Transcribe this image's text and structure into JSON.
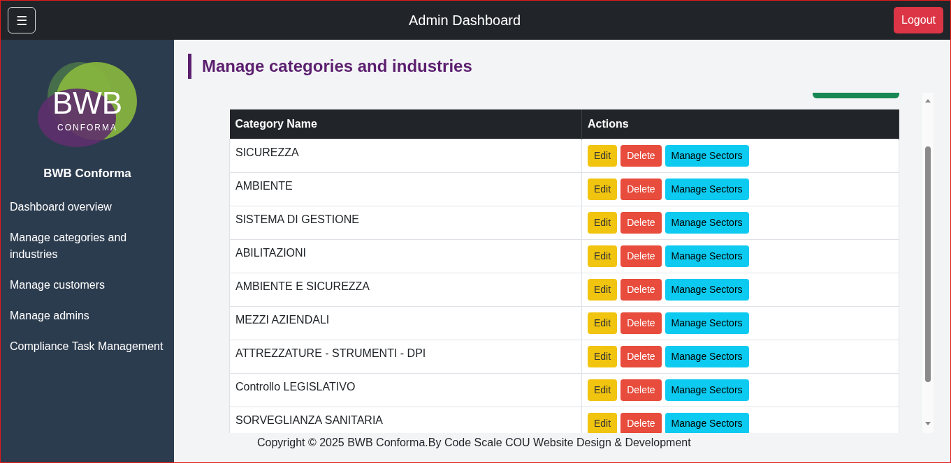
{
  "header": {
    "menu_button": "☰",
    "title": "Admin Dashboard",
    "logout": "Logout"
  },
  "sidebar": {
    "logo": {
      "mark": "BWB",
      "subtitle": "CONFORMA"
    },
    "brand": "BWB Conforma",
    "items": [
      {
        "label": "Dashboard overview"
      },
      {
        "label": "Manage categories and industries"
      },
      {
        "label": "Manage customers"
      },
      {
        "label": "Manage admins"
      },
      {
        "label": "Compliance Task Management"
      }
    ]
  },
  "page_title": "Manage categories and industries",
  "table": {
    "columns": [
      "Category Name",
      "Actions"
    ],
    "rows": [
      {
        "name": "SICUREZZA",
        "actions": [
          "Edit",
          "Delete",
          "Manage Sectors"
        ]
      },
      {
        "name": "AMBIENTE",
        "actions": [
          "Edit",
          "Delete",
          "Manage Sectors"
        ]
      },
      {
        "name": "SISTEMA DI GESTIONE",
        "actions": [
          "Edit",
          "Delete",
          "Manage Sectors"
        ]
      },
      {
        "name": "ABILITAZIONI",
        "actions": [
          "Edit",
          "Delete",
          "Manage Sectors"
        ]
      },
      {
        "name": "AMBIENTE E SICUREZZA",
        "actions": [
          "Edit",
          "Delete",
          "Manage Sectors"
        ]
      },
      {
        "name": "MEZZI AZIENDALI",
        "actions": [
          "Edit",
          "Delete",
          "Manage Sectors"
        ]
      },
      {
        "name": "ATTREZZATURE - STRUMENTI - DPI",
        "actions": [
          "Edit",
          "Delete",
          "Manage Sectors"
        ]
      },
      {
        "name": "Controllo LEGISLATIVO",
        "actions": [
          "Edit",
          "Delete",
          "Manage Sectors"
        ]
      },
      {
        "name": "SORVEGLIANZA SANITARIA",
        "actions": [
          "Edit",
          "Delete",
          "Manage Sectors"
        ]
      }
    ]
  },
  "footer": "Copyright © 2025 BWB Conforma.By Code Scale COU Website Design & Development"
}
